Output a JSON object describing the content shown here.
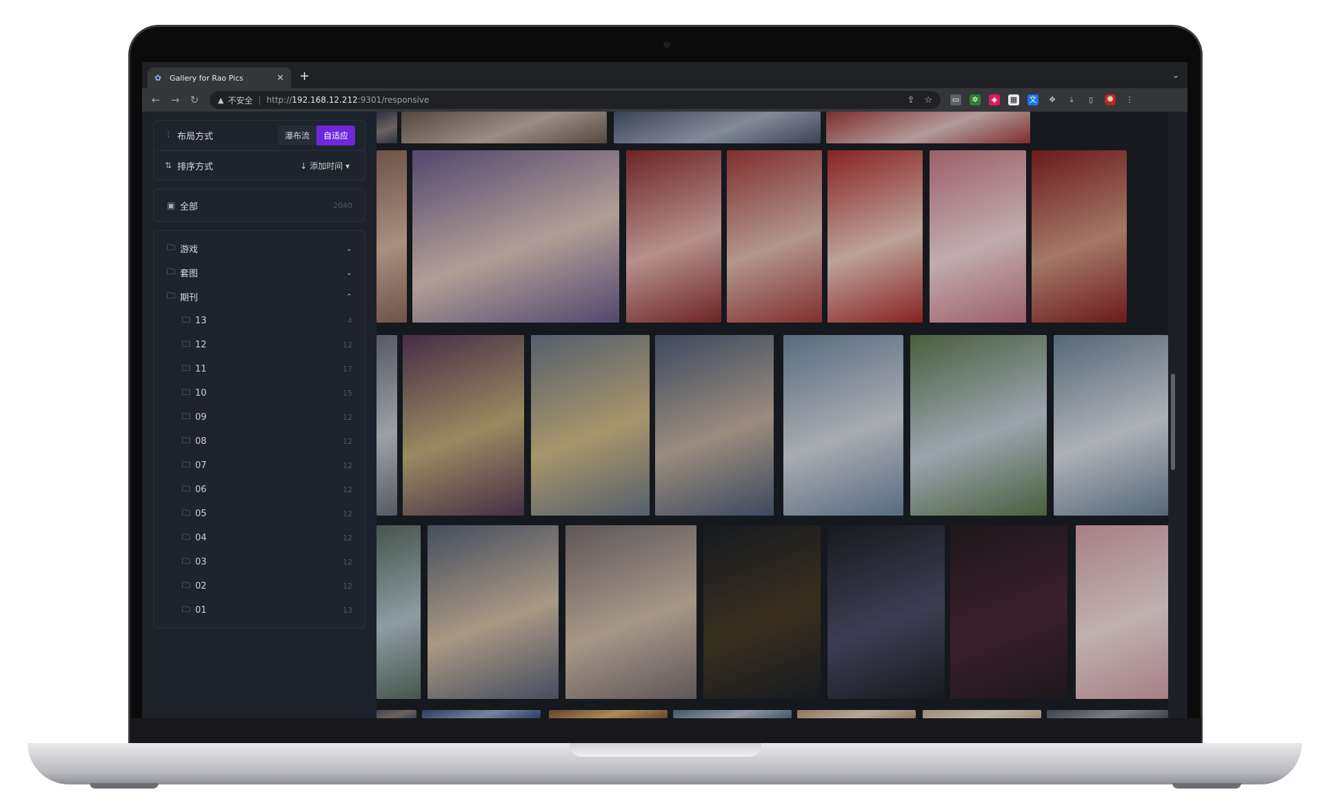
{
  "browser": {
    "tab_title": "Gallery for Rao Pics",
    "url_insecure_label": "不安全",
    "url_prefix": "http://",
    "url_host": "192.168.12.212",
    "url_path": ":9301/responsive"
  },
  "sidebar": {
    "layout_label": "布局方式",
    "layout_options": [
      "瀑布流",
      "自适应"
    ],
    "layout_active": "自适应",
    "sort_label": "排序方式",
    "sort_value": "↓ 添加时间",
    "all": {
      "label": "全部",
      "count": "2040"
    },
    "folders": [
      {
        "label": "游戏",
        "expanded": false
      },
      {
        "label": "套图",
        "expanded": false
      },
      {
        "label": "期刊",
        "expanded": true
      }
    ],
    "issues": [
      {
        "label": "13",
        "count": "4"
      },
      {
        "label": "12",
        "count": "12"
      },
      {
        "label": "11",
        "count": "17"
      },
      {
        "label": "10",
        "count": "15"
      },
      {
        "label": "09",
        "count": "12"
      },
      {
        "label": "08",
        "count": "12"
      },
      {
        "label": "07",
        "count": "12"
      },
      {
        "label": "06",
        "count": "12"
      },
      {
        "label": "05",
        "count": "12"
      },
      {
        "label": "04",
        "count": "12"
      },
      {
        "label": "03",
        "count": "12"
      },
      {
        "label": "02",
        "count": "12"
      },
      {
        "label": "01",
        "count": "13"
      }
    ]
  },
  "icons": {
    "layout": "sliders-icon",
    "sort": "sort-icon",
    "all": "inbox-icon",
    "folder": "folder-icon",
    "expand": "chevron-down-icon",
    "collapse": "chevron-up-icon"
  },
  "colors": {
    "accent": "#6d28d9",
    "sidebar_bg": "#1c222b",
    "page_bg": "#15181d"
  }
}
